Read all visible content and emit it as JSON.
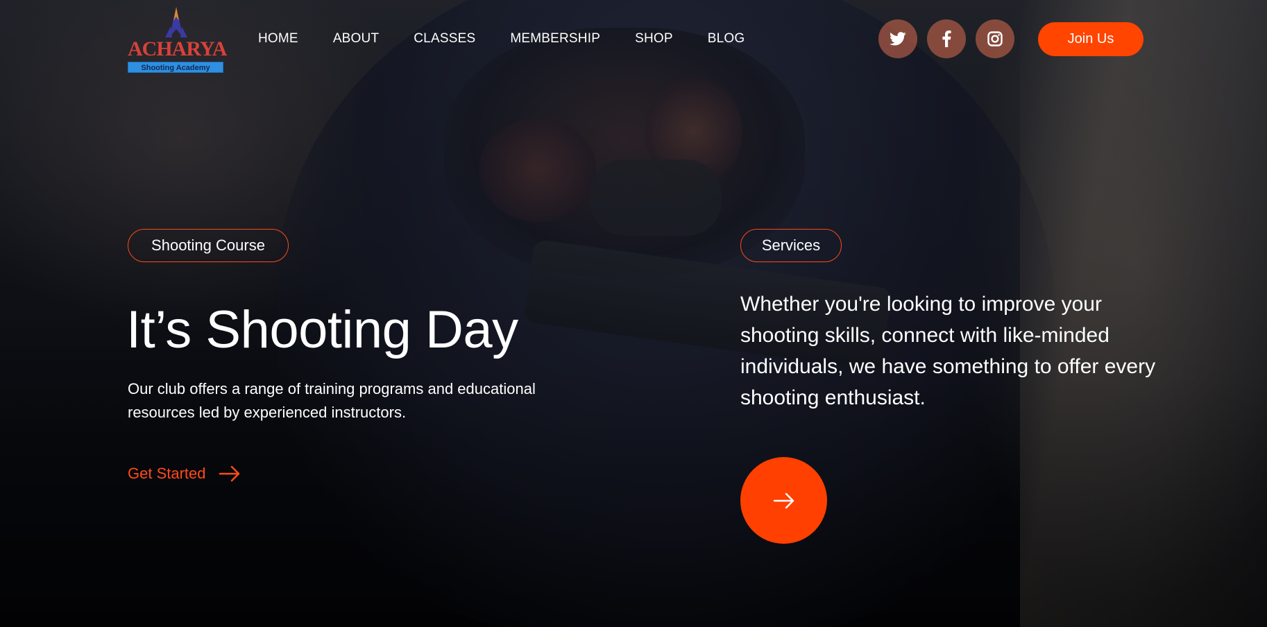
{
  "brand": {
    "wordmark": "ACHARYA",
    "tagline": "Shooting Academy"
  },
  "nav": {
    "items": [
      "HOME",
      "ABOUT",
      "CLASSES",
      "MEMBERSHIP",
      "SHOP",
      "BLOG"
    ]
  },
  "social": {
    "icons": [
      "twitter-icon",
      "facebook-icon",
      "instagram-icon"
    ]
  },
  "header": {
    "join_label": "Join Us"
  },
  "hero": {
    "course_pill": "Shooting Course",
    "headline": "It’s Shooting Day",
    "subtext": "Our club offers a range of training programs and educational resources led by experienced instructors.",
    "cta_label": "Get Started",
    "services_pill": "Services",
    "services_text": "Whether you're looking to improve your shooting skills, connect with like-minded individuals, we have something to offer every shooting enthusiast."
  },
  "colors": {
    "accent": "#ff4500",
    "social_bg": "#c86a50",
    "text": "#ffffff"
  }
}
